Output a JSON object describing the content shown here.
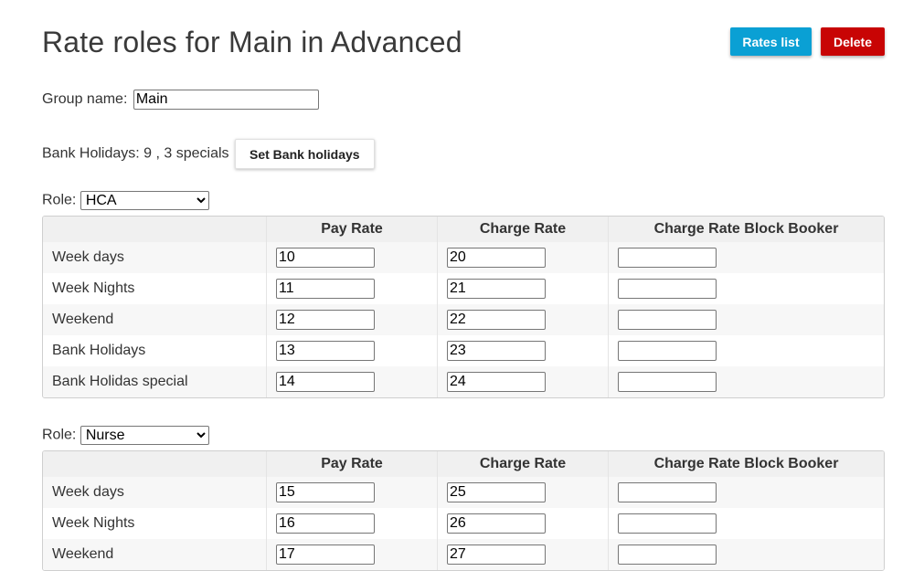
{
  "page": {
    "title": "Rate roles for Main in Advanced",
    "rates_list_label": "Rates list",
    "delete_label": "Delete"
  },
  "group": {
    "label": "Group name:",
    "value": "Main"
  },
  "bank": {
    "text": "Bank Holidays: 9 , 3 specials",
    "button_label": "Set Bank holidays"
  },
  "columns": [
    "",
    "Pay Rate",
    "Charge Rate",
    "Charge Rate Block Booker"
  ],
  "roles": [
    {
      "label": "Role:",
      "selected": "HCA",
      "rows": [
        {
          "name": "Week days",
          "pay": "10",
          "charge": "20",
          "block": ""
        },
        {
          "name": "Week Nights",
          "pay": "11",
          "charge": "21",
          "block": ""
        },
        {
          "name": "Weekend",
          "pay": "12",
          "charge": "22",
          "block": ""
        },
        {
          "name": "Bank Holidays",
          "pay": "13",
          "charge": "23",
          "block": ""
        },
        {
          "name": "Bank Holidas special",
          "pay": "14",
          "charge": "24",
          "block": ""
        }
      ]
    },
    {
      "label": "Role:",
      "selected": "Nurse",
      "rows": [
        {
          "name": "Week days",
          "pay": "15",
          "charge": "25",
          "block": ""
        },
        {
          "name": "Week Nights",
          "pay": "16",
          "charge": "26",
          "block": ""
        },
        {
          "name": "Weekend",
          "pay": "17",
          "charge": "27",
          "block": ""
        }
      ]
    }
  ],
  "colors": {
    "rates_list": "#0aa0d4",
    "delete": "#c80404",
    "header_bg": "#f0f0f0"
  }
}
